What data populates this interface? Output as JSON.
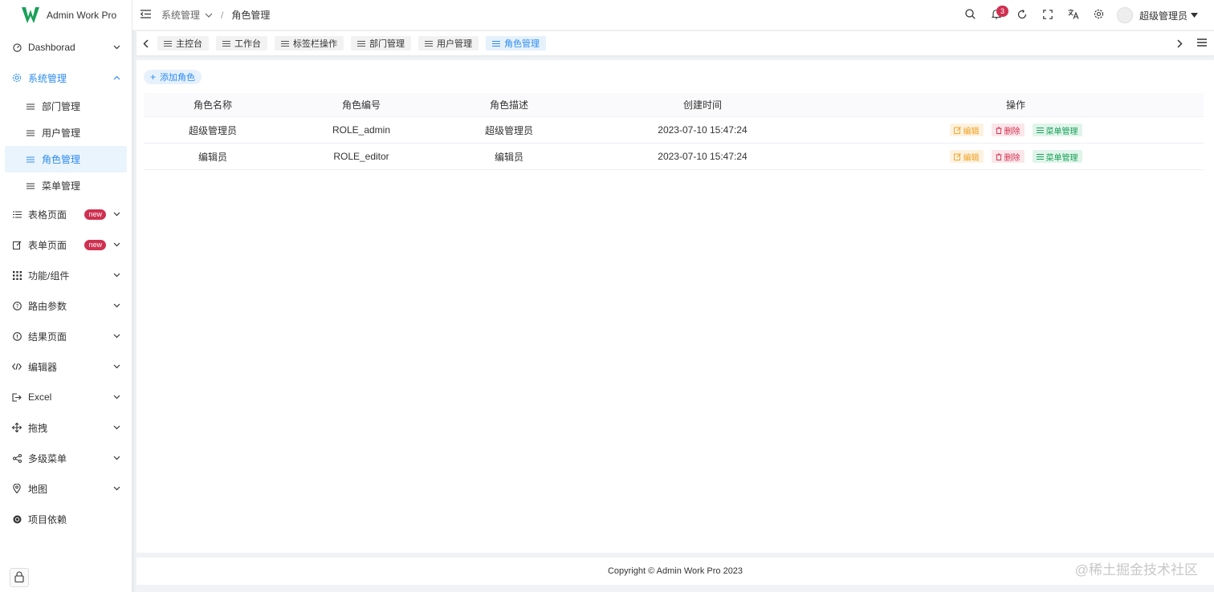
{
  "app": {
    "name": "Admin Work Pro",
    "brand_color": "#18a058",
    "accent": "#2d8cf0"
  },
  "sidebar": {
    "items": [
      {
        "label": "Dashborad",
        "icon": "dashboard-icon"
      },
      {
        "label": "系统管理",
        "icon": "gear-icon",
        "open": true,
        "children": [
          {
            "label": "部门管理"
          },
          {
            "label": "用户管理"
          },
          {
            "label": "角色管理",
            "active": true
          },
          {
            "label": "菜单管理"
          }
        ]
      },
      {
        "label": "表格页面",
        "icon": "list-icon",
        "badge": "new"
      },
      {
        "label": "表单页面",
        "icon": "edit-form-icon",
        "badge": "new"
      },
      {
        "label": "功能/组件",
        "icon": "grid-icon"
      },
      {
        "label": "路由参数",
        "icon": "help-circle-icon"
      },
      {
        "label": "结果页面",
        "icon": "info-circle-icon"
      },
      {
        "label": "编辑器",
        "icon": "code-icon"
      },
      {
        "label": "Excel",
        "icon": "export-icon"
      },
      {
        "label": "拖拽",
        "icon": "move-icon"
      },
      {
        "label": "多级菜单",
        "icon": "share-icon"
      },
      {
        "label": "地图",
        "icon": "location-icon"
      },
      {
        "label": "项目依赖",
        "icon": "package-icon"
      }
    ]
  },
  "header": {
    "breadcrumb": {
      "parent": "系统管理",
      "separator": "/",
      "current": "角色管理"
    },
    "notification_count": "3",
    "user_name": "超级管理员"
  },
  "tabs": [
    {
      "label": "主控台"
    },
    {
      "label": "工作台"
    },
    {
      "label": "标签栏操作"
    },
    {
      "label": "部门管理"
    },
    {
      "label": "用户管理"
    },
    {
      "label": "角色管理",
      "active": true
    }
  ],
  "content": {
    "add_button": "添加角色",
    "table": {
      "columns": [
        "角色名称",
        "角色编号",
        "角色描述",
        "创建时间",
        "操作"
      ],
      "rows": [
        {
          "name": "超级管理员",
          "code": "ROLE_admin",
          "desc": "超级管理员",
          "created": "2023-07-10 15:47:24"
        },
        {
          "name": "编辑员",
          "code": "ROLE_editor",
          "desc": "编辑员",
          "created": "2023-07-10 15:47:24"
        }
      ],
      "actions": {
        "edit": "编辑",
        "delete": "删除",
        "menu": "菜单管理"
      }
    }
  },
  "footer": {
    "copyright": "Copyright © Admin Work Pro 2023"
  },
  "watermark": "@稀土掘金技术社区"
}
